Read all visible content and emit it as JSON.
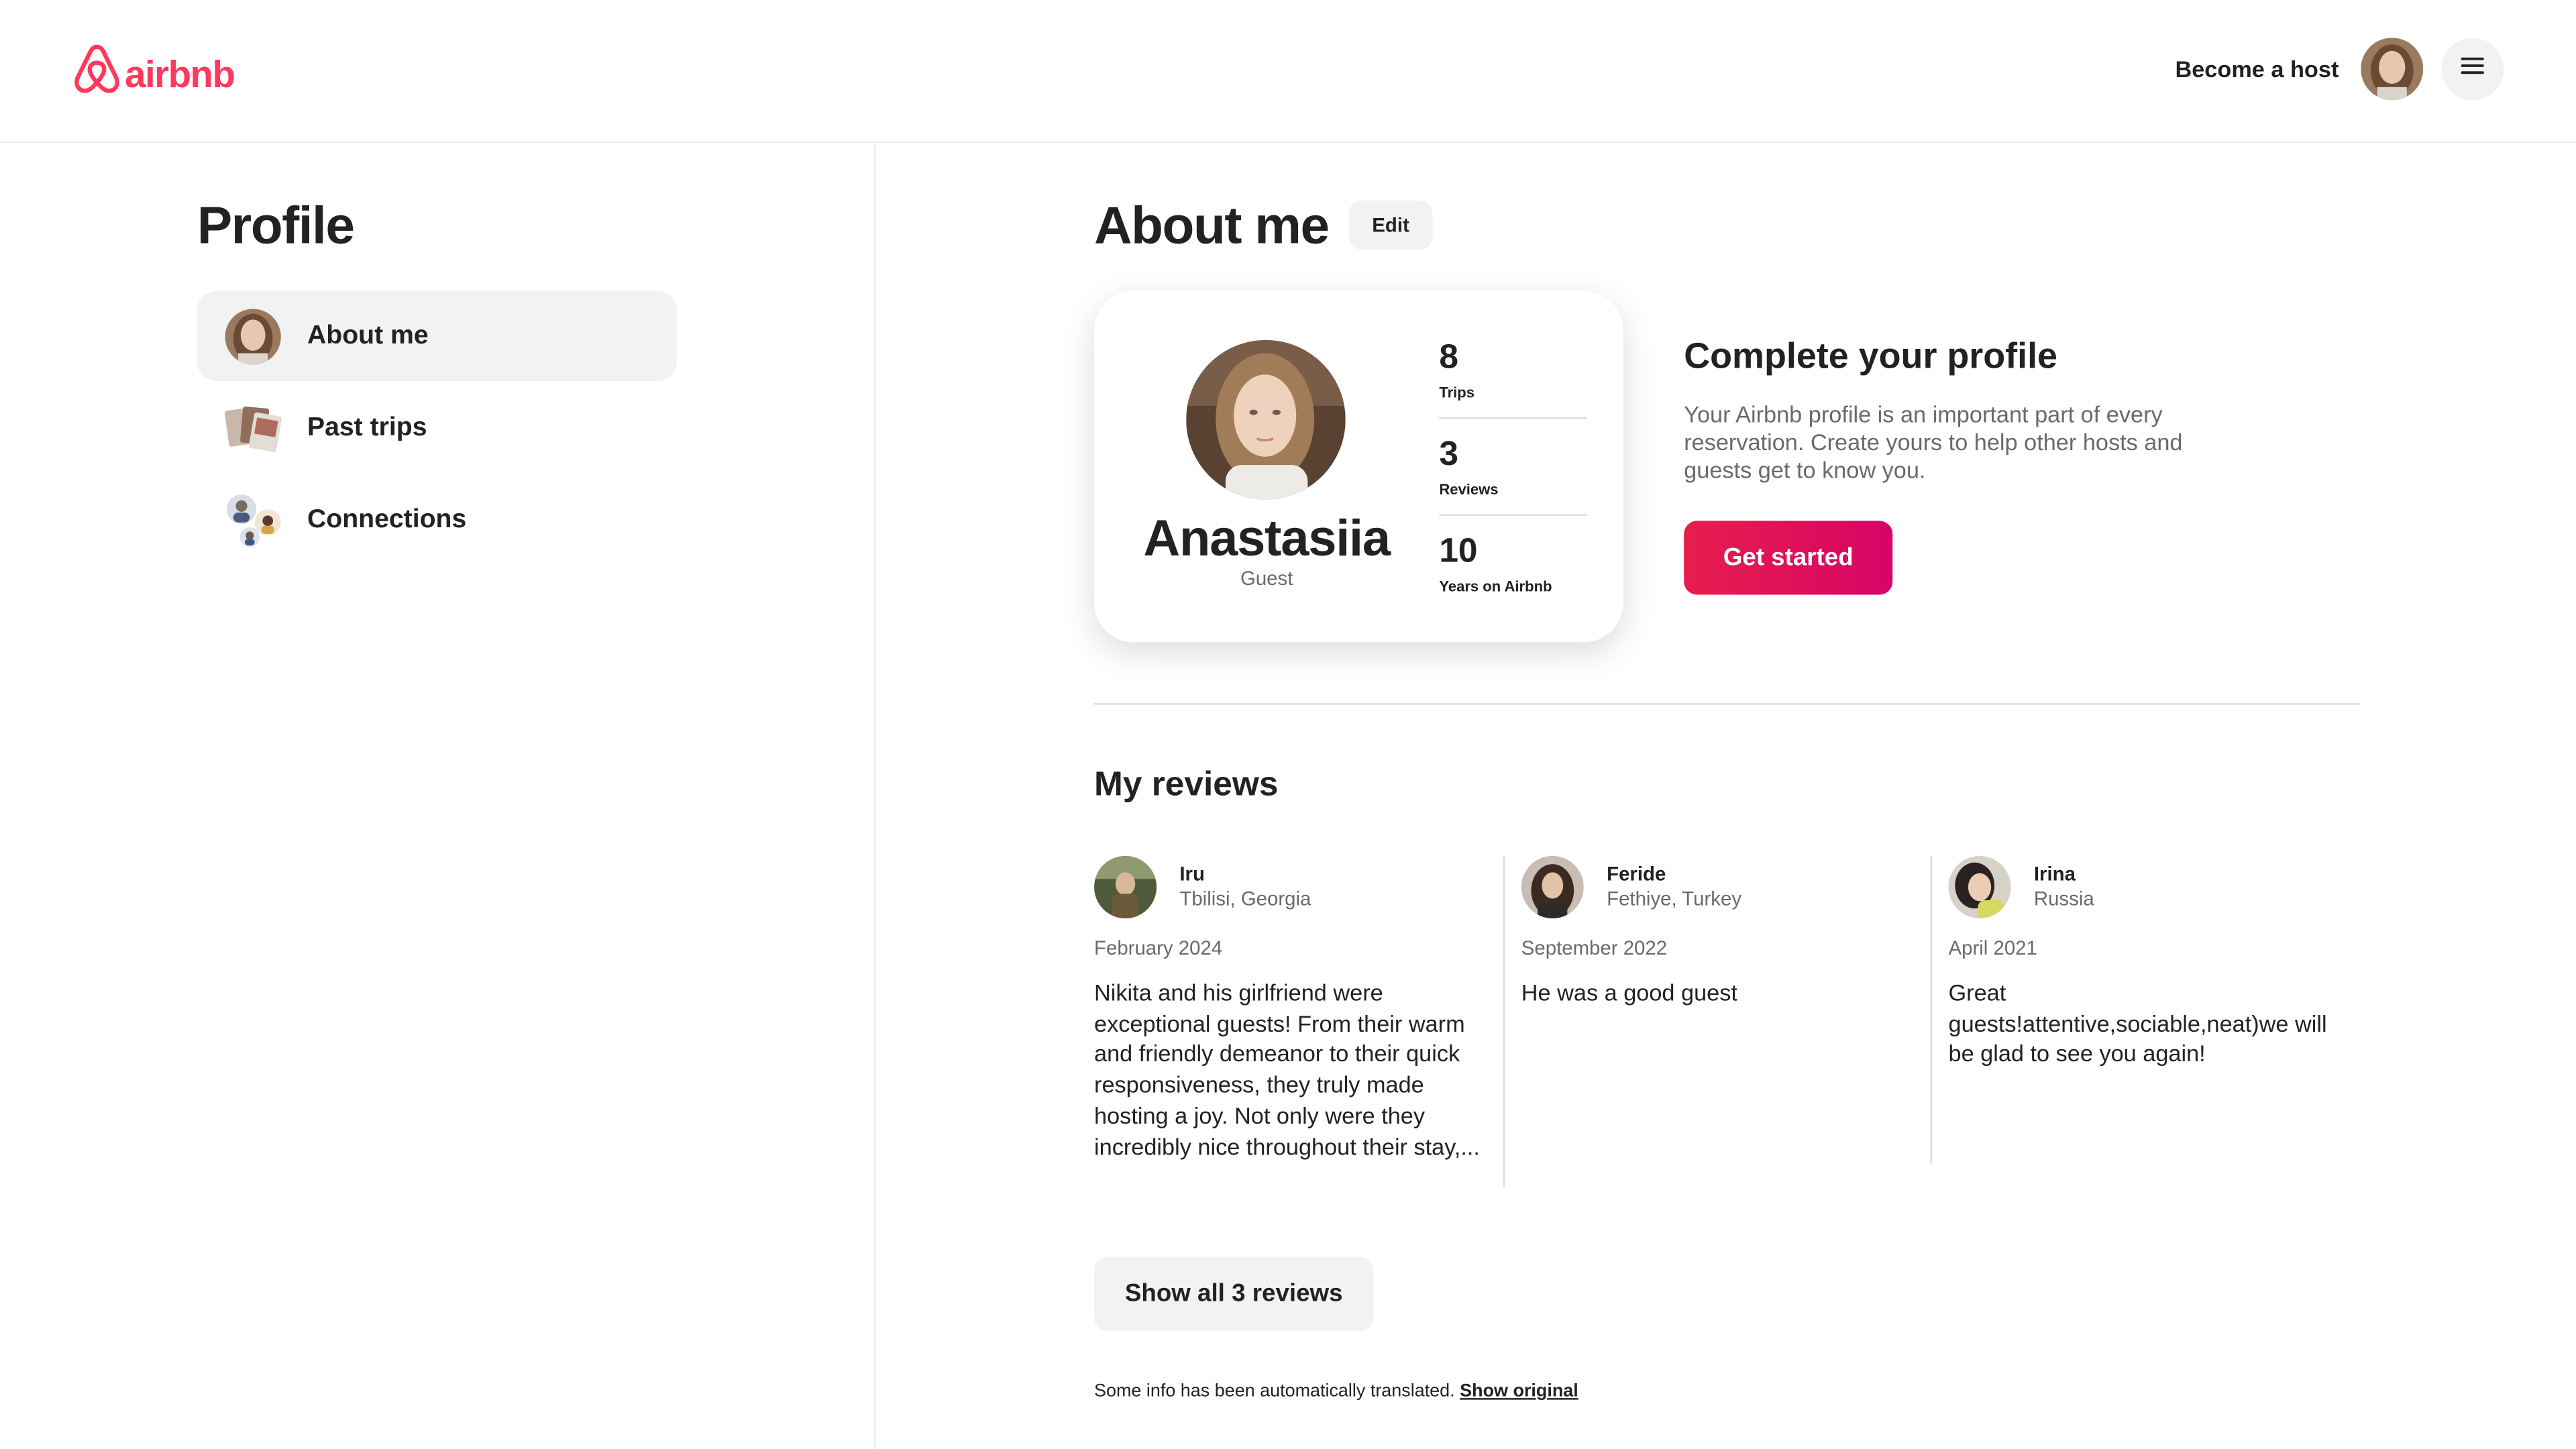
{
  "header": {
    "logo_text": "airbnb",
    "become_host_label": "Become a host"
  },
  "sidebar": {
    "title": "Profile",
    "items": [
      {
        "label": "About me",
        "active": true,
        "icon": "user-avatar-icon"
      },
      {
        "label": "Past trips",
        "active": false,
        "icon": "past-trips-icon"
      },
      {
        "label": "Connections",
        "active": false,
        "icon": "connections-icon"
      }
    ]
  },
  "about": {
    "title": "About me",
    "edit_label": "Edit",
    "name": "Anastasiia",
    "role": "Guest",
    "stats": [
      {
        "value": "8",
        "label": "Trips"
      },
      {
        "value": "3",
        "label": "Reviews"
      },
      {
        "value": "10",
        "label": "Years on Airbnb"
      }
    ]
  },
  "complete_profile": {
    "title": "Complete your profile",
    "description": "Your Airbnb profile is an important part of every reservation. Create yours to help other hosts and guests get to know you.",
    "button_label": "Get started"
  },
  "reviews": {
    "title": "My reviews",
    "items": [
      {
        "name": "Iru",
        "location": "Tbilisi, Georgia",
        "date": "February 2024",
        "text": "Nikita and his girlfriend were exceptional guests! From their warm and friendly demeanor to their quick responsiveness, they truly made hosting a joy. Not only were they incredibly nice throughout their stay,..."
      },
      {
        "name": "Feride",
        "location": "Fethiye, Turkey",
        "date": "September 2022",
        "text": "He was a good guest"
      },
      {
        "name": "Irina",
        "location": "Russia",
        "date": "April 2021",
        "text": "Great guests!attentive,sociable,neat)we will be glad to see you again!"
      }
    ],
    "show_all_label": "Show all 3 reviews"
  },
  "footer_note": {
    "text": "Some info has been automatically translated.",
    "link_label": "Show original"
  },
  "colors": {
    "brand": "#ff385c",
    "cta_start": "#e61e4d",
    "cta_end": "#d70466",
    "muted_text": "#6a6a6a",
    "divider": "#dddddd"
  }
}
